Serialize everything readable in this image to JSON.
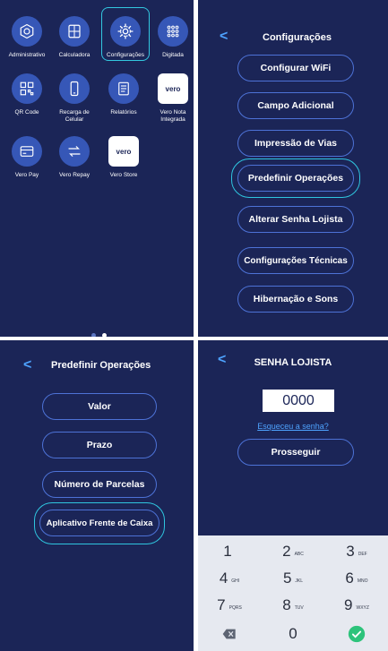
{
  "colors": {
    "panel_bg": "#1b2557",
    "icon_bg": "#3657b7",
    "pill_border": "#4d72d6",
    "highlight": "#2fc6df",
    "link": "#4ea3ff",
    "keypad_bg": "#e6e9f0",
    "confirm": "#2dc37b"
  },
  "launcher": {
    "apps": [
      {
        "label": "Administrativo",
        "icon": "hexagon-icon"
      },
      {
        "label": "Calculadora",
        "icon": "calculator-icon"
      },
      {
        "label": "Configurações",
        "icon": "gear-icon",
        "selected": true
      },
      {
        "label": "Digitada",
        "icon": "keypad-icon"
      },
      {
        "label": "QR Code",
        "icon": "qr-code-icon"
      },
      {
        "label": "Recarga de Celular",
        "icon": "phone-icon"
      },
      {
        "label": "Relatórios",
        "icon": "document-icon"
      },
      {
        "label": "Vero Nota Integrada",
        "icon": "vero-logo-icon",
        "logo_text": "vero"
      },
      {
        "label": "Vero Pay",
        "icon": "card-icon"
      },
      {
        "label": "Vero Repay",
        "icon": "swap-arrows-icon"
      },
      {
        "label": "Vero Store",
        "icon": "vero-logo-icon",
        "logo_text": "vero"
      }
    ],
    "page_dots": 2
  },
  "settings": {
    "title": "Configurações",
    "back": "<",
    "items": [
      "Configurar WiFi",
      "Campo Adicional",
      "Impressão de Vias",
      "Predefinir Operações",
      "Alterar Senha Lojista",
      "Configurações Técnicas",
      "Hibernação e Sons"
    ],
    "highlighted_index": 3
  },
  "predefinir": {
    "title": "Predefinir Operações",
    "back": "<",
    "items": [
      "Valor",
      "Prazo",
      "Número de Parcelas",
      "Aplicativo Frente de Caixa"
    ],
    "highlighted_index": 3
  },
  "senha": {
    "title": "SENHA LOJISTA",
    "back": "<",
    "pin_value": "0000",
    "forgot_link": "Esqueceu a senha?",
    "continue_button": "Prosseguir",
    "keys": [
      {
        "digit": "1",
        "letters": ""
      },
      {
        "digit": "2",
        "letters": "ABC"
      },
      {
        "digit": "3",
        "letters": "DEF"
      },
      {
        "digit": "4",
        "letters": "GHI"
      },
      {
        "digit": "5",
        "letters": "JKL"
      },
      {
        "digit": "6",
        "letters": "MNO"
      },
      {
        "digit": "7",
        "letters": "PQRS"
      },
      {
        "digit": "8",
        "letters": "TUV"
      },
      {
        "digit": "9",
        "letters": "WXYZ"
      },
      {
        "digit": "",
        "letters": "",
        "icon": "backspace-icon"
      },
      {
        "digit": "0",
        "letters": ""
      },
      {
        "digit": "",
        "letters": "",
        "icon": "check-icon"
      }
    ]
  }
}
